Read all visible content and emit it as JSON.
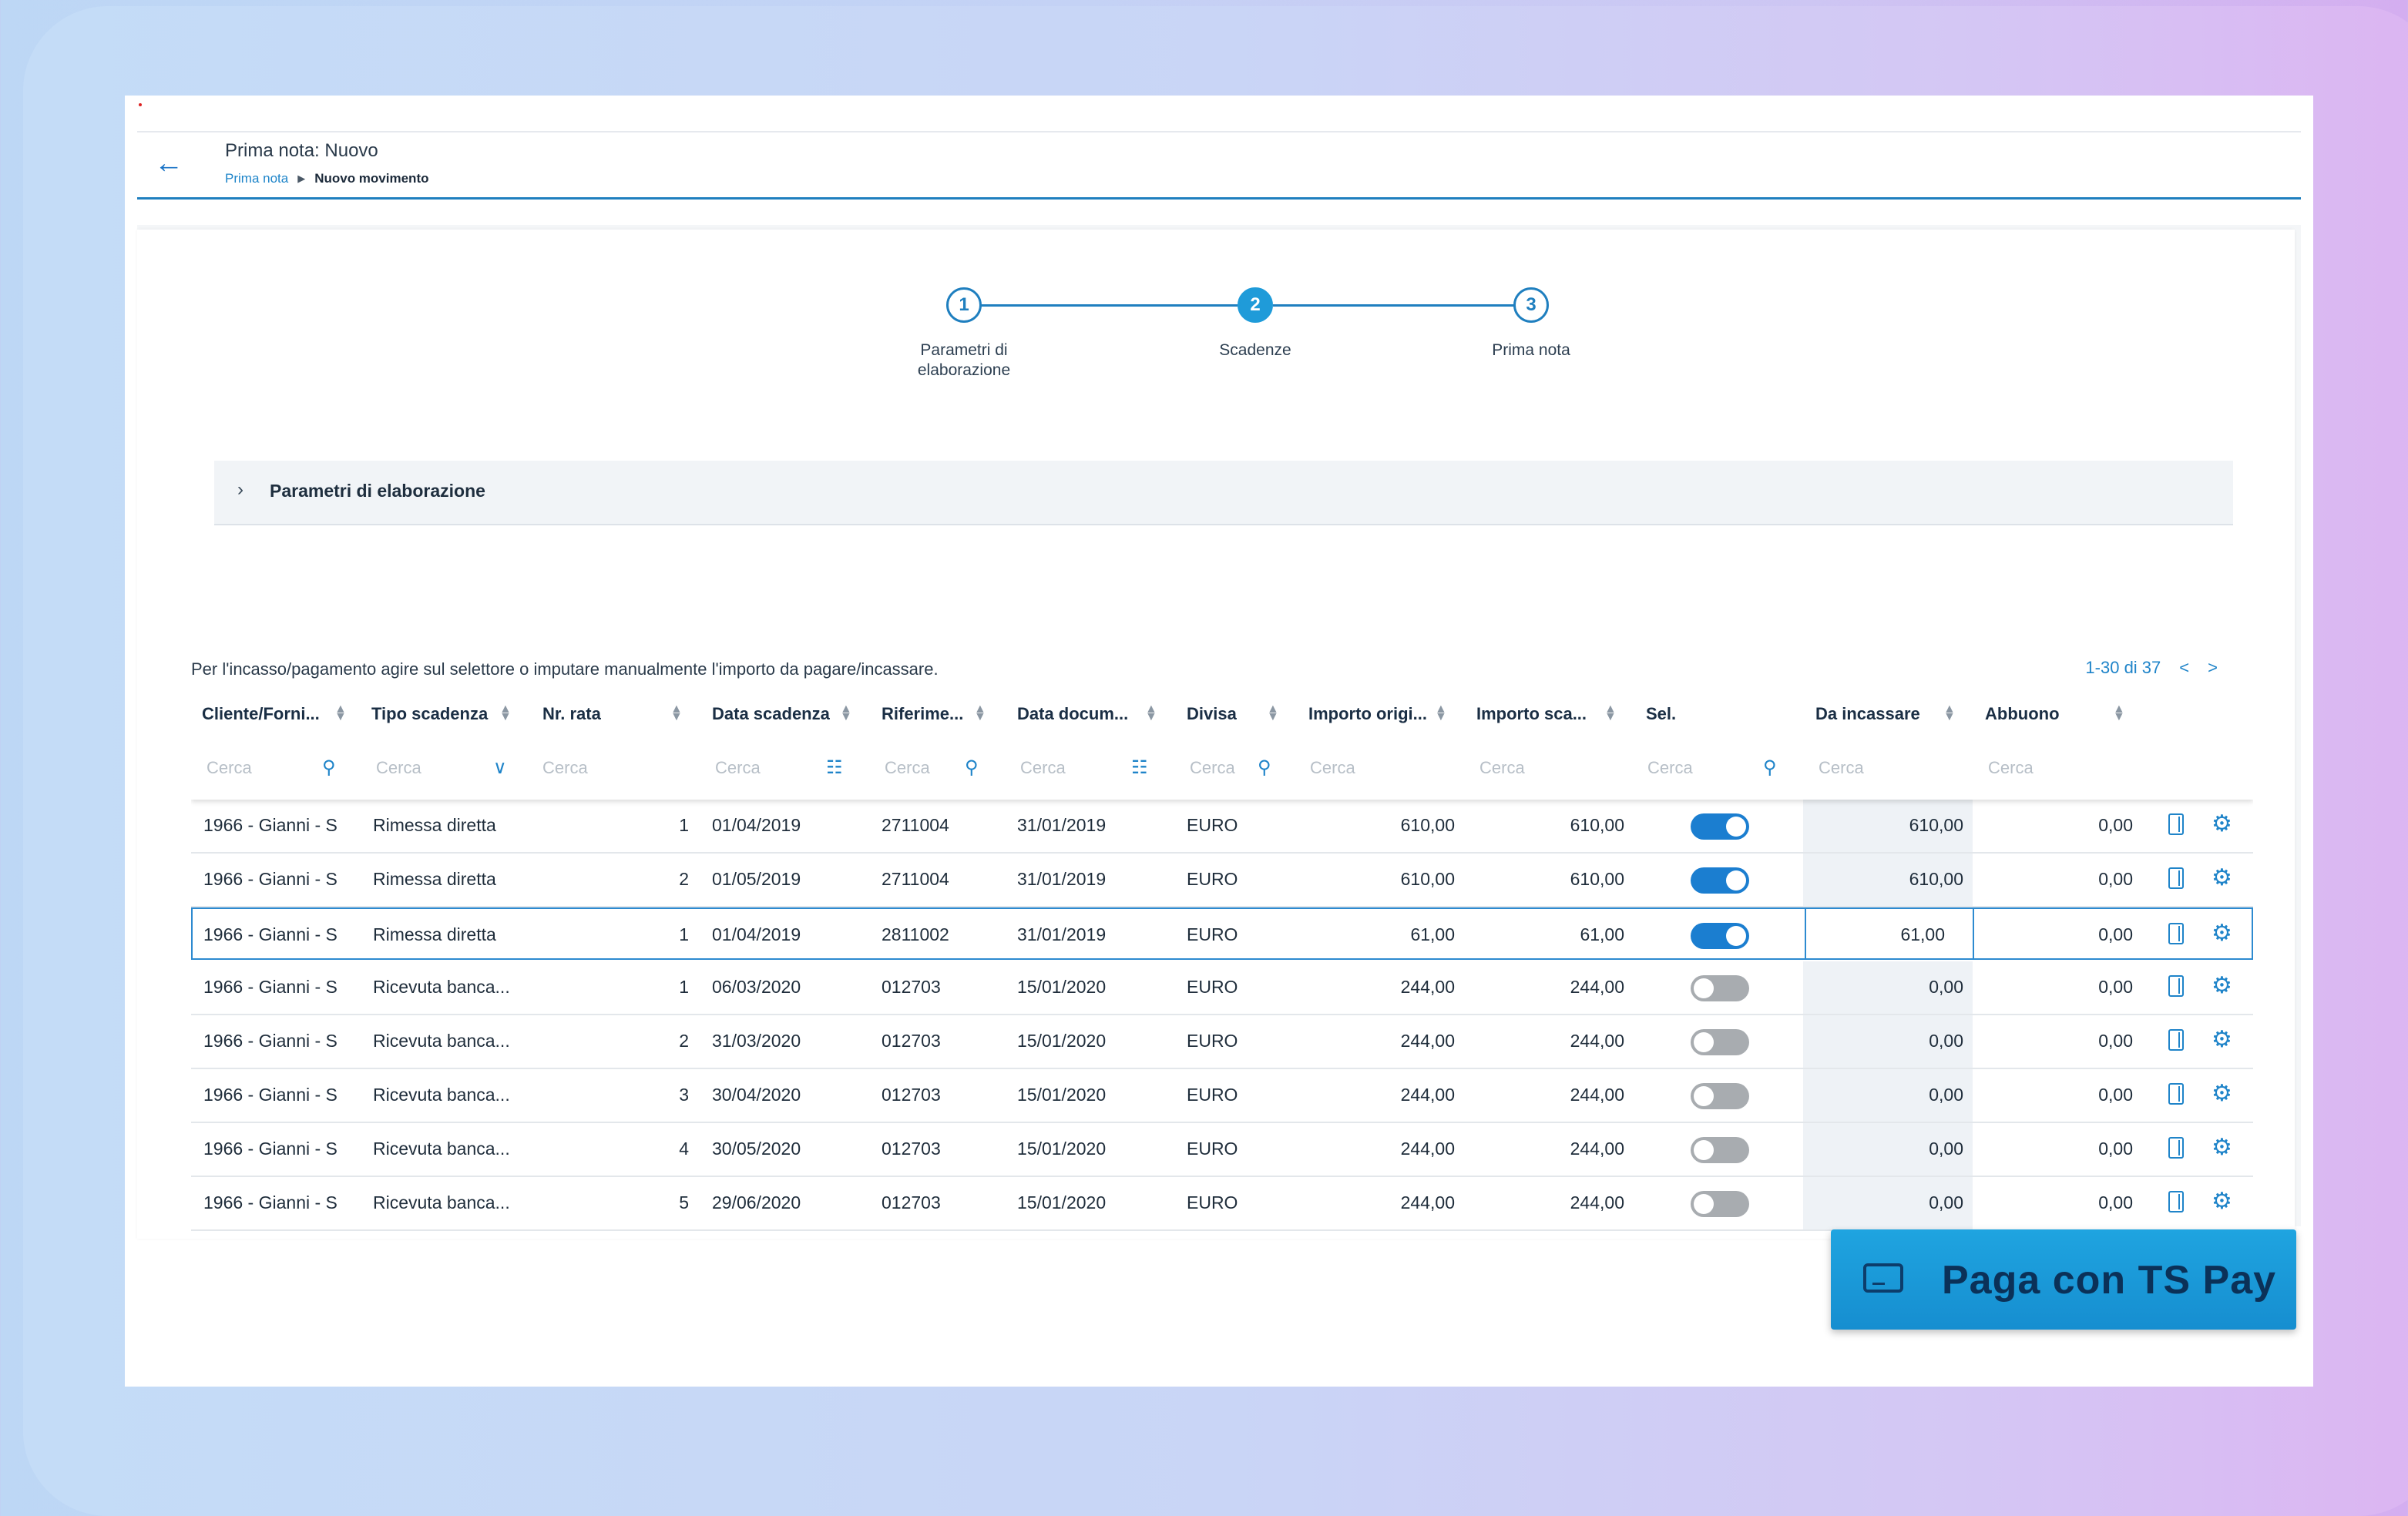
{
  "header": {
    "title": "Prima nota: Nuovo",
    "breadcrumb": [
      "Prima nota",
      "Nuovo movimento"
    ]
  },
  "stepper": {
    "steps": [
      {
        "number": "1",
        "label": "Parametri di elaborazione",
        "label_lines": [
          "Parametri di",
          "elaborazione"
        ]
      },
      {
        "number": "2",
        "label": "Scadenze",
        "active": true
      },
      {
        "number": "3",
        "label": "Prima nota"
      }
    ]
  },
  "accordion": {
    "label": "Parametri di elaborazione",
    "expanded": false
  },
  "info_text": "Per l'incasso/pagamento agire sul selettore o imputare manualmente l'importo da pagare/incassare.",
  "pagination": {
    "range": "1-30 di 37",
    "prev": "<",
    "next": ">"
  },
  "table": {
    "columns": [
      "Cliente/Forni...",
      "Tipo scadenza",
      "Nr. rata",
      "Data scadenza",
      "Riferime...",
      "Data docum...",
      "Divisa",
      "Importo origi...",
      "Importo sca...",
      "Sel.",
      "Da incassare",
      "Abbuono"
    ],
    "filter_placeholder": "Cerca",
    "rows": [
      {
        "cliente": "1966 - Gianni - S",
        "tipo": "Rimessa diretta",
        "rata": "1",
        "data_scadenza": "01/04/2019",
        "riferimento": "2711004",
        "data_doc": "31/01/2019",
        "divisa": "EURO",
        "importo_orig": "610,00",
        "importo_sca": "610,00",
        "sel": true,
        "da_incassare": "610,00",
        "abbuono": "0,00"
      },
      {
        "cliente": "1966 - Gianni - S",
        "tipo": "Rimessa diretta",
        "rata": "2",
        "data_scadenza": "01/05/2019",
        "riferimento": "2711004",
        "data_doc": "31/01/2019",
        "divisa": "EURO",
        "importo_orig": "610,00",
        "importo_sca": "610,00",
        "sel": true,
        "da_incassare": "610,00",
        "abbuono": "0,00"
      },
      {
        "cliente": "1966 - Gianni - S",
        "tipo": "Rimessa diretta",
        "rata": "1",
        "data_scadenza": "01/04/2019",
        "riferimento": "2811002",
        "data_doc": "31/01/2019",
        "divisa": "EURO",
        "importo_orig": "61,00",
        "importo_sca": "61,00",
        "sel": true,
        "da_incassare": "61,00",
        "abbuono": "0,00",
        "selected": true
      },
      {
        "cliente": "1966 - Gianni - S",
        "tipo": "Ricevuta banca...",
        "rata": "1",
        "data_scadenza": "06/03/2020",
        "riferimento": "012703",
        "data_doc": "15/01/2020",
        "divisa": "EURO",
        "importo_orig": "244,00",
        "importo_sca": "244,00",
        "sel": false,
        "da_incassare": "0,00",
        "abbuono": "0,00"
      },
      {
        "cliente": "1966 - Gianni - S",
        "tipo": "Ricevuta banca...",
        "rata": "2",
        "data_scadenza": "31/03/2020",
        "riferimento": "012703",
        "data_doc": "15/01/2020",
        "divisa": "EURO",
        "importo_orig": "244,00",
        "importo_sca": "244,00",
        "sel": false,
        "da_incassare": "0,00",
        "abbuono": "0,00"
      },
      {
        "cliente": "1966 - Gianni - S",
        "tipo": "Ricevuta banca...",
        "rata": "3",
        "data_scadenza": "30/04/2020",
        "riferimento": "012703",
        "data_doc": "15/01/2020",
        "divisa": "EURO",
        "importo_orig": "244,00",
        "importo_sca": "244,00",
        "sel": false,
        "da_incassare": "0,00",
        "abbuono": "0,00"
      },
      {
        "cliente": "1966 - Gianni - S",
        "tipo": "Ricevuta banca...",
        "rata": "4",
        "data_scadenza": "30/05/2020",
        "riferimento": "012703",
        "data_doc": "15/01/2020",
        "divisa": "EURO",
        "importo_orig": "244,00",
        "importo_sca": "244,00",
        "sel": false,
        "da_incassare": "0,00",
        "abbuono": "0,00"
      },
      {
        "cliente": "1966 - Gianni - S",
        "tipo": "Ricevuta banca...",
        "rata": "5",
        "data_scadenza": "29/06/2020",
        "riferimento": "012703",
        "data_doc": "15/01/2020",
        "divisa": "EURO",
        "importo_orig": "244,00",
        "importo_sca": "244,00",
        "sel": false,
        "da_incassare": "0,00",
        "abbuono": "0,00"
      }
    ]
  },
  "pay_button": {
    "label": "Paga con TS Pay"
  },
  "colors": {
    "accent": "#1f84c9",
    "toggle_on": "#1b7ed0",
    "toggle_off": "#a8acb0",
    "pay_button": "#1a9ad8"
  }
}
